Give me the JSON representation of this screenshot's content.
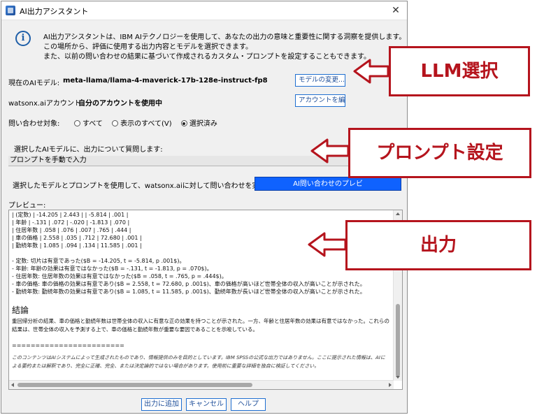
{
  "window": {
    "title": "AI出力アシスタント",
    "close_glyph": "✕"
  },
  "info": {
    "icon": "info-icon",
    "lines": [
      "AI出力アシスタントは、IBM AIテクノロジーを使用して、あなたの出力の意味と重要性に関する洞察を提供します。",
      "この場所から、評価に使用する出力内容とモデルを選択できます。",
      "また、以前の問い合わせの結果に基づいて作成されるカスタム・プロンプトを設定することもできます。"
    ]
  },
  "model": {
    "label": "現在のAIモデル:",
    "value": "meta-llama/llama-4-maverick-17b-128e-instruct-fp8",
    "change_button": "モデルの変更..."
  },
  "account": {
    "label": "watsonx.aiアカウント:",
    "value": "自分のアカウントを使用中",
    "edit_button": "アカウントを編..."
  },
  "query_target": {
    "label": "問い合わせ対象:",
    "options": [
      {
        "label": "すべて",
        "checked": false
      },
      {
        "label": "表示のすべて(V)",
        "checked": false
      },
      {
        "label": "選択済み",
        "checked": true
      }
    ]
  },
  "question_label": "選択したAIモデルに、出力について質問します:",
  "prompt_input_value": "プロンプトを手動で入力",
  "run_label": "選択したモデルとプロンプトを使用して、watsonx.aiに対して問い合わせを実行します:",
  "run_button": "AI問い合わせのプレビ",
  "preview": {
    "label": "プレビュー:",
    "table_rows": [
      "| (定数) | -14.205 | 2.443 | | -5.814 | .001 |",
      "| 年齢 | -.131 | .072 | -.020 | -1.813 | .070 |",
      "| 住居年数 | .058 | .076 | .007 | .765 | .444 |",
      "| 車の価格 | 2.558 | .035 | .712 | 72.680 | .001 |",
      "| 勤続年数 | 1.085 | .094 | .134 | 11.585 | .001 |"
    ],
    "bullets": [
      "- 定数: 切片は有意であった($B = -14.205, t = -5.814, p .001$)。",
      "- 年齢: 年齢の効果は有意ではなかった($B = -.131, t = -1.813, p = .070$)。",
      "- 住居年数: 住居年数の効果は有意ではなかった($B = .058, t = .765, p = .444$)。",
      "- 車の価格: 車の価格の効果は有意であり($B = 2.558, t = 72.680, p .001$)、車の価格が高いほど世帯全体の収入が高いことが示された。",
      "- 勤続年数: 勤続年数の効果は有意であり($B = 1.085, t = 11.585, p .001$)、勤続年数が長いほど世帯全体の収入が高いことが示された。"
    ],
    "heading": "結論",
    "conclusion": "重回帰分析の結果、車の価格と勤続年数は世帯全体の収入に有意な正の効果を持つことが示された。一方、年齢と住居年数の効果は有意ではなかった。これらの結果は、世帯全体の収入を予測する上で、車の価格と勤続年数が重要な要因であることを示唆している。",
    "separator": "========================",
    "disclaimer": "このコンテンツはAIシステムによって生成されたものであり、情報提供のみを目的としています。IBM SPSSの公式な出力ではありません。ここに提示された情報は、AIによる要約または解釈であり、完全に正確、完全、または決定論的ではない場合があります。使用前に重要な詳細を独自に検証してください。"
  },
  "footer": {
    "add_button": "出力に追加",
    "cancel_button": "キャンセル",
    "help_button": "ヘルプ"
  },
  "callouts": {
    "llm": "LLM選択",
    "prompt": "プロンプト設定",
    "output": "出力",
    "color": "#b5141d"
  }
}
